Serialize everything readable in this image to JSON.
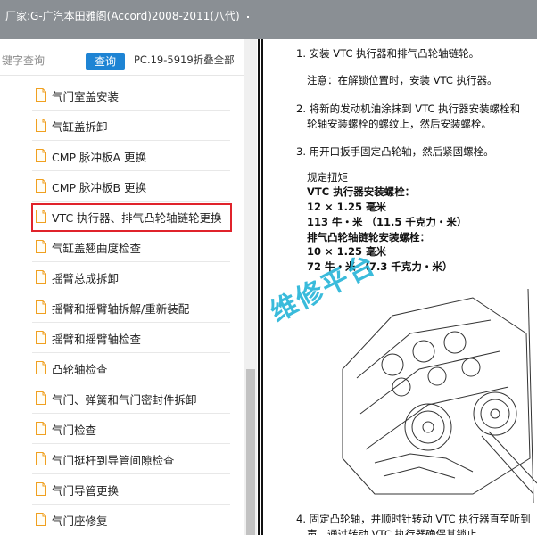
{
  "window": {
    "title": "厂家:G-广汽本田雅阁(Accord)2008-2011(八代)"
  },
  "search": {
    "placeholder": "键字查询",
    "button_label": "查询",
    "note": "PC.19-5919折叠全部"
  },
  "tree": {
    "items": [
      {
        "label": "气门室盖安装",
        "selected": false
      },
      {
        "label": "气缸盖拆卸",
        "selected": false
      },
      {
        "label": "CMP 脉冲板A 更换",
        "selected": false
      },
      {
        "label": "CMP 脉冲板B 更换",
        "selected": false
      },
      {
        "label": "VTC 执行器、排气凸轮轴链轮更换",
        "selected": true
      },
      {
        "label": "气缸盖翘曲度检查",
        "selected": false
      },
      {
        "label": "摇臂总成拆卸",
        "selected": false
      },
      {
        "label": "摇臂和摇臂轴拆解/重新装配",
        "selected": false
      },
      {
        "label": "摇臂和摇臂轴检查",
        "selected": false
      },
      {
        "label": "凸轮轴检查",
        "selected": false
      },
      {
        "label": "气门、弹簧和气门密封件拆卸",
        "selected": false
      },
      {
        "label": "气门检查",
        "selected": false
      },
      {
        "label": "气门挺杆到导管间隙检查",
        "selected": false
      },
      {
        "label": "气门导管更换",
        "selected": false
      },
      {
        "label": "气门座修复",
        "selected": false
      }
    ]
  },
  "document": {
    "step1": "1. 安装 VTC 执行器和排气凸轮轴链轮。",
    "note1": "注意：在解锁位置时，安装 VTC 执行器。",
    "step2_line1": "2. 将新的发动机油涂抹到 VTC 执行器安装螺栓和",
    "step2_line2": "轮轴安装螺栓的螺纹上，然后安装螺栓。",
    "step3": "3. 用开口扳手固定凸轮轴，然后紧固螺栓。",
    "torque_heading": "规定扭矩",
    "vtc_bolt_label": "VTC 执行器安装螺栓：",
    "vtc_bolt_size": "12 × 1.25 毫米",
    "vtc_bolt_torque": "113 牛・米 （11.5 千克力・米）",
    "sprocket_bolt_label": "排气凸轮轴链轮安装螺栓：",
    "sprocket_bolt_size": "10 × 1.25 毫米",
    "sprocket_bolt_torque": "72 牛・米 （7.3 千克力・米）",
    "step4_line1": "4. 固定凸轮轴，并顺时针转动 VTC 执行器直至听到",
    "step4_line2": "声，通过转动 VTC 执行器确保其锁止。",
    "watermark": "维修平台"
  },
  "colors": {
    "titlebar": "#8a8f94",
    "search_button": "#1e84d4",
    "selection_border": "#e0232b",
    "watermark": "#25b4d8",
    "file_icon": "#f0a020"
  },
  "icons": {
    "tree_item": "document-icon"
  }
}
